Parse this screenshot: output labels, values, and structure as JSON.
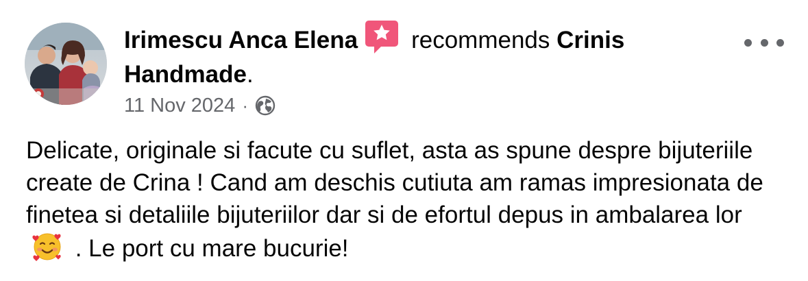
{
  "post": {
    "author": "Irimescu Anca Elena",
    "recommends_text": "recommends",
    "page_name": "Crinis Handmade",
    "period": ".",
    "date": "11 Nov 2024",
    "separator": "·",
    "privacy_icon": "globe-icon",
    "recommend_badge_icon": "star-speech-bubble-icon",
    "more_icon": "more-options-icon",
    "body_part1": "Delicate, originale si facute cu suflet, asta as spune despre bijuteriile create de Crina ! Cand am deschis cutiuta am ramas impresionata de finetea si detaliile bijuteriilor dar si de efortul depus in ambalarea lor",
    "emoji": "smiling-face-with-hearts",
    "body_part2": " . Le port cu mare bucurie!"
  },
  "colors": {
    "text_primary": "#050505",
    "text_secondary": "#65676b",
    "recommend_badge": "#f0567a"
  }
}
